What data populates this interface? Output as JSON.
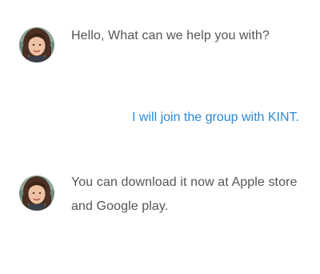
{
  "colors": {
    "incoming_text": "#555555",
    "outgoing_text": "#2a8ad8",
    "background": "#ffffff"
  },
  "messages": [
    {
      "direction": "incoming",
      "avatar_icon": "woman-portrait-avatar",
      "text": "Hello, What can we help you with?"
    },
    {
      "direction": "outgoing",
      "text": "I will join the group with KINT."
    },
    {
      "direction": "incoming",
      "avatar_icon": "woman-portrait-avatar",
      "text": "You can download it now at Apple store and Google play."
    }
  ]
}
